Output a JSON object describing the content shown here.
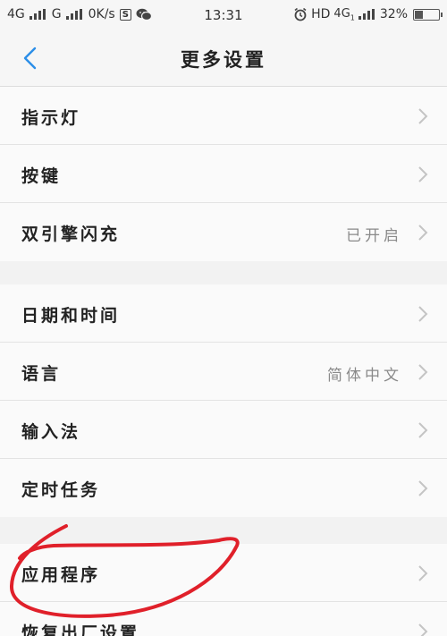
{
  "status_bar": {
    "net1": "4G",
    "net2": "G",
    "speed": "0K/s",
    "s_badge": "S",
    "wechat_icon": "wechat-icon",
    "time": "13:31",
    "alarm_icon": "alarm-icon",
    "hd": "HD",
    "net3": "4G",
    "net3_sub": "1",
    "battery": "32%",
    "battery_level": 0.32
  },
  "header": {
    "title": "更多设置",
    "back_icon": "chevron-left-icon"
  },
  "groups": [
    {
      "items": [
        {
          "label": "指示灯",
          "value": ""
        },
        {
          "label": "按键",
          "value": ""
        },
        {
          "label": "双引擎闪充",
          "value": "已开启"
        }
      ]
    },
    {
      "items": [
        {
          "label": "日期和时间",
          "value": ""
        },
        {
          "label": "语言",
          "value": "简体中文"
        },
        {
          "label": "输入法",
          "value": ""
        },
        {
          "label": "定时任务",
          "value": ""
        }
      ]
    },
    {
      "items": [
        {
          "label": "应用程序",
          "value": ""
        },
        {
          "label": "恢复出厂设置",
          "value": ""
        }
      ]
    }
  ],
  "colors": {
    "accent": "#2b8ee8",
    "annotation": "#e0202a",
    "chevron": "#c4c4c4"
  }
}
